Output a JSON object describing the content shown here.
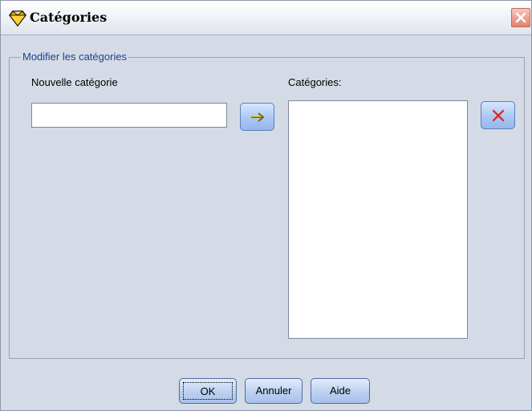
{
  "window": {
    "title": "Catégories"
  },
  "group": {
    "legend": "Modifier les catégories"
  },
  "new_category": {
    "label": "Nouvelle catégorie",
    "value": "",
    "placeholder": ""
  },
  "categories": {
    "label": "Catégories:",
    "items": []
  },
  "buttons": {
    "ok": "OK",
    "cancel": "Annuler",
    "help": "Aide"
  },
  "icons": {
    "app": "diamond-app-icon",
    "close": "close-icon",
    "add": "arrow-right-icon",
    "delete": "delete-x-icon"
  },
  "colors": {
    "arrow": "#e8c800",
    "delete_x": "#e0201a",
    "legend_text": "#1f3f8f"
  }
}
